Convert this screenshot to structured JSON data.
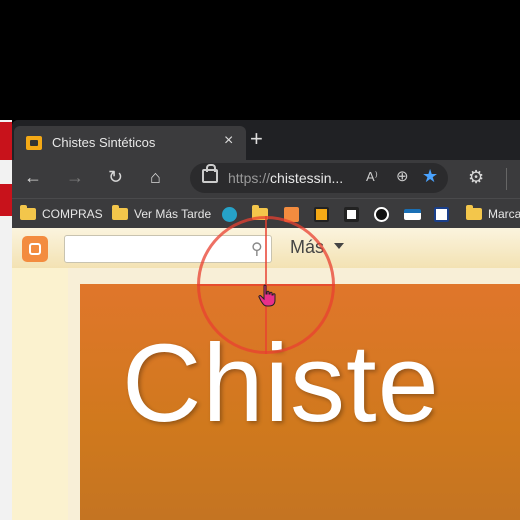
{
  "tab": {
    "title": "Chistes Sintéticos",
    "close": "×",
    "new_tab": "+"
  },
  "toolbar": {
    "back": "←",
    "forward": "→",
    "reload": "↻",
    "home": "⌂",
    "url_scheme": "https://",
    "url_host": "chistessin...",
    "read_aloud": "A⁾",
    "zoom": "⊕",
    "favorite": "★",
    "extensions": "⚙"
  },
  "bookmarks": [
    {
      "label": "COMPRAS",
      "icon": "folder-icon"
    },
    {
      "label": "Ver Más Tarde",
      "icon": "folder-icon"
    },
    {
      "label": "",
      "icon": "p-icon"
    },
    {
      "label": "",
      "icon": "folder-icon"
    },
    {
      "label": "",
      "icon": "blogger-icon"
    },
    {
      "label": "",
      "icon": "blogger-dark-icon"
    },
    {
      "label": "",
      "icon": "site-icon"
    },
    {
      "label": "",
      "icon": "github-icon"
    },
    {
      "label": "",
      "icon": "site-icon"
    },
    {
      "label": "",
      "icon": "site-icon"
    },
    {
      "label": "Marca",
      "icon": "folder-icon"
    }
  ],
  "navbar": {
    "search_placeholder": "",
    "more": "Más"
  },
  "header": {
    "title": "Chiste"
  },
  "colors": {
    "accent": "#e0762b",
    "target": "#e84030",
    "favorite": "#4aa3ff"
  }
}
